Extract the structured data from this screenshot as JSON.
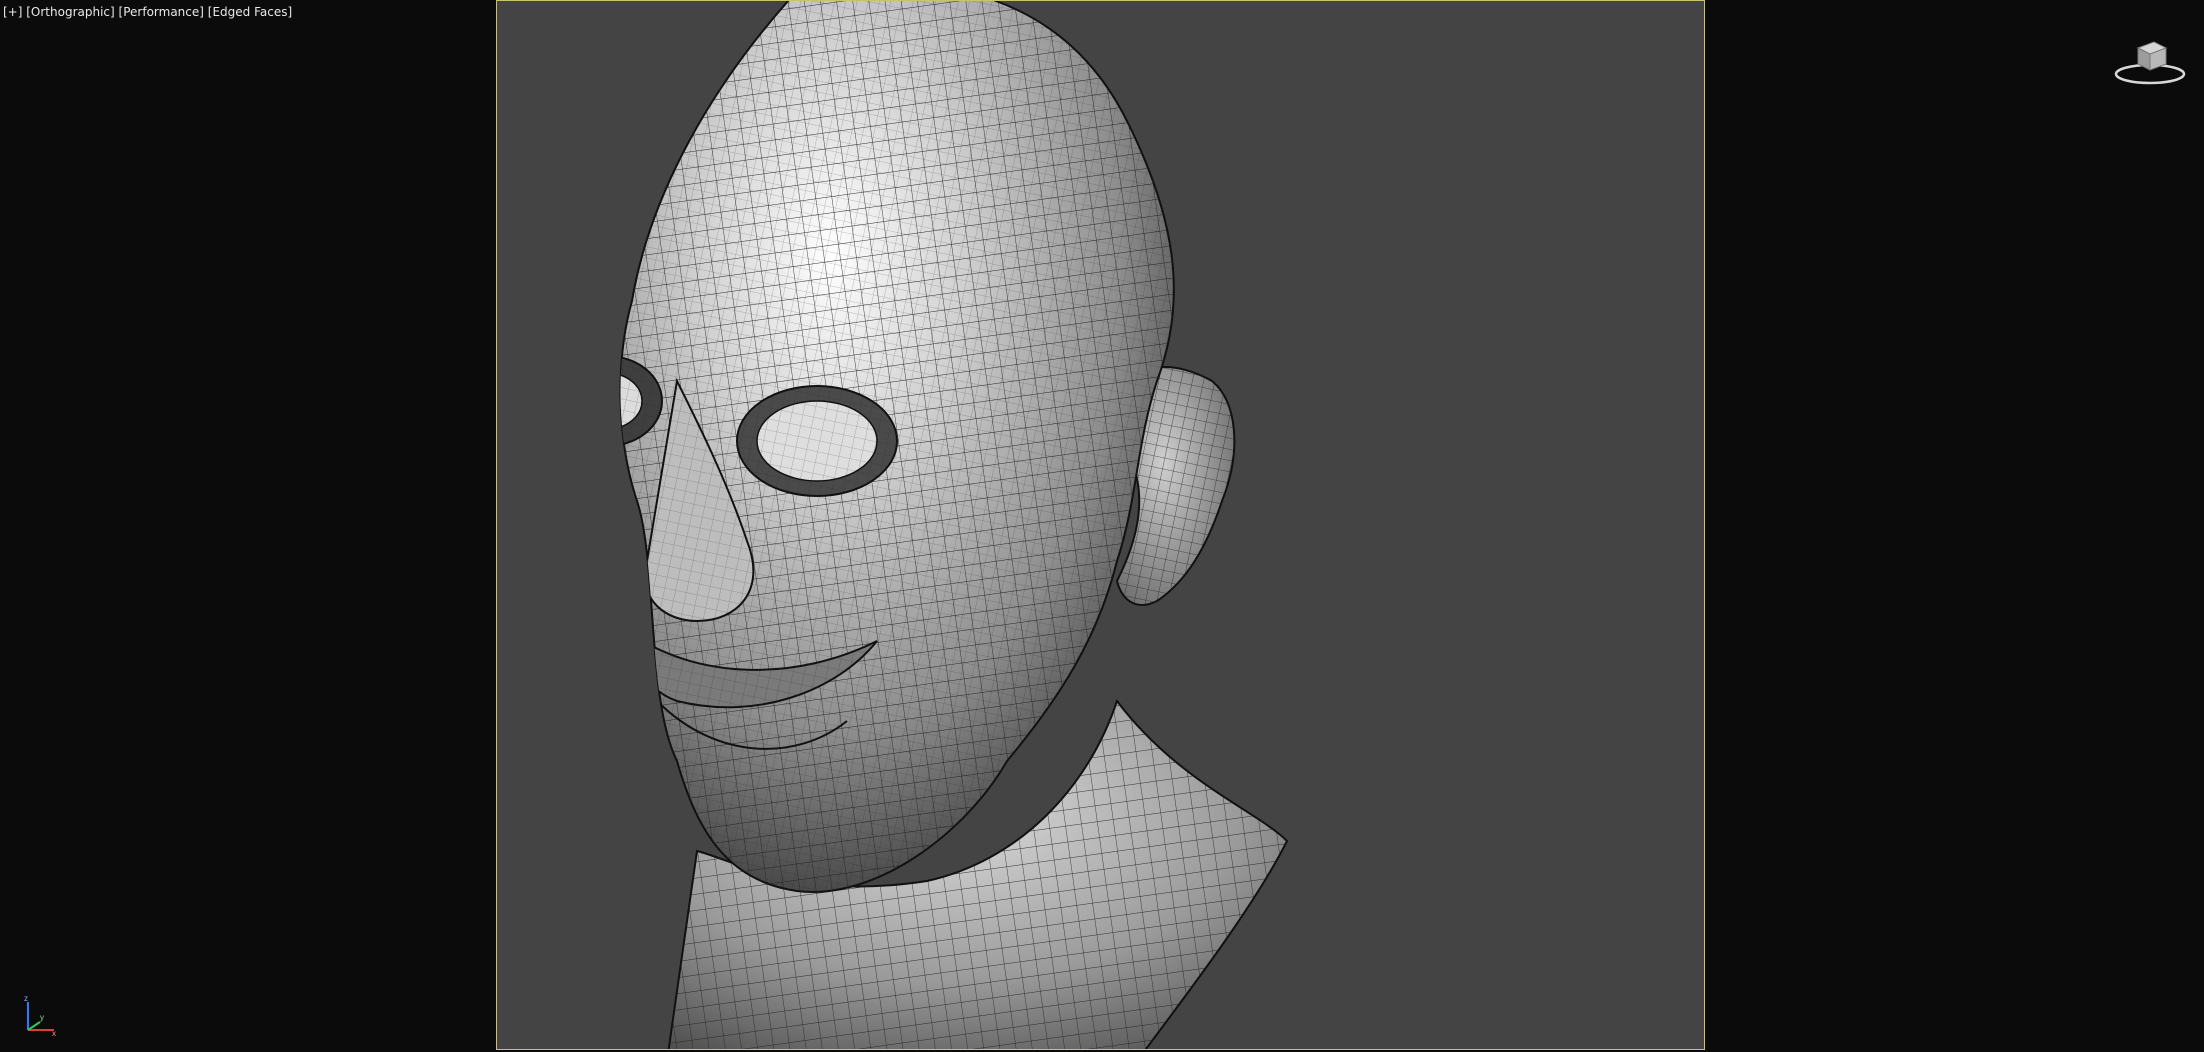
{
  "viewport": {
    "label": {
      "plus": "[+]",
      "view": "[Orthographic]",
      "shading": "[Performance]",
      "edged": "[Edged Faces]"
    },
    "model": "head-mesh",
    "frame_color": "#c9c46a",
    "background": "#444444",
    "outer_background": "#0b0b0b"
  },
  "viewcube": {
    "icon": "viewcube-icon"
  },
  "axis_gizmo": {
    "icon": "axis-tripod-icon",
    "x": "x",
    "y": "y",
    "z": "z"
  }
}
